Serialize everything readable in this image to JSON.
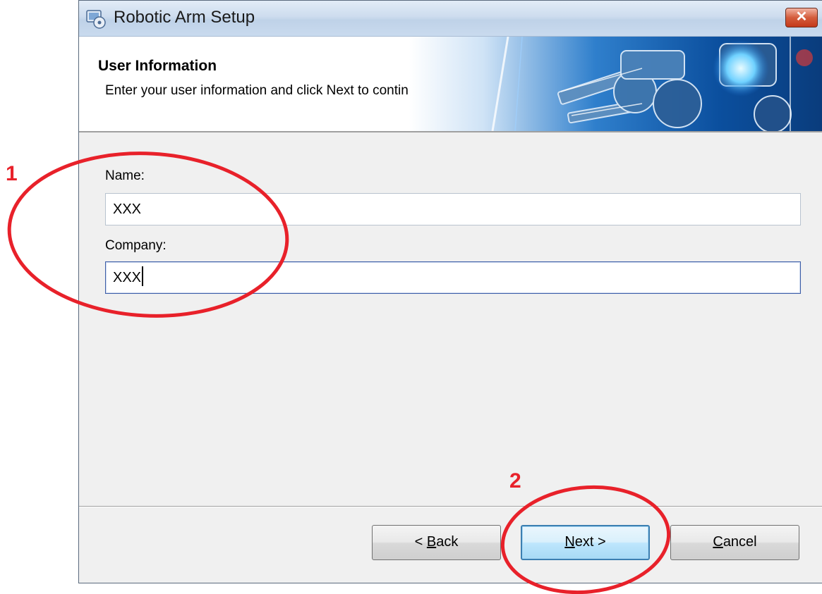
{
  "window": {
    "title": "Robotic Arm Setup",
    "close_label": "✕"
  },
  "header": {
    "title": "User Information",
    "subtitle": "Enter your user information and click Next to continue."
  },
  "form": {
    "name_label": "Name:",
    "name_value": "XXX",
    "company_label": "Company:",
    "company_value": "XXX"
  },
  "buttons": {
    "back": {
      "prefix": "< ",
      "accel": "B",
      "rest": "ack"
    },
    "next": {
      "accel": "N",
      "rest": "ext >"
    },
    "cancel": {
      "accel": "C",
      "rest": "ancel"
    }
  },
  "annotations": {
    "step1": "1",
    "step2": "2",
    "color": "#e8212a"
  }
}
